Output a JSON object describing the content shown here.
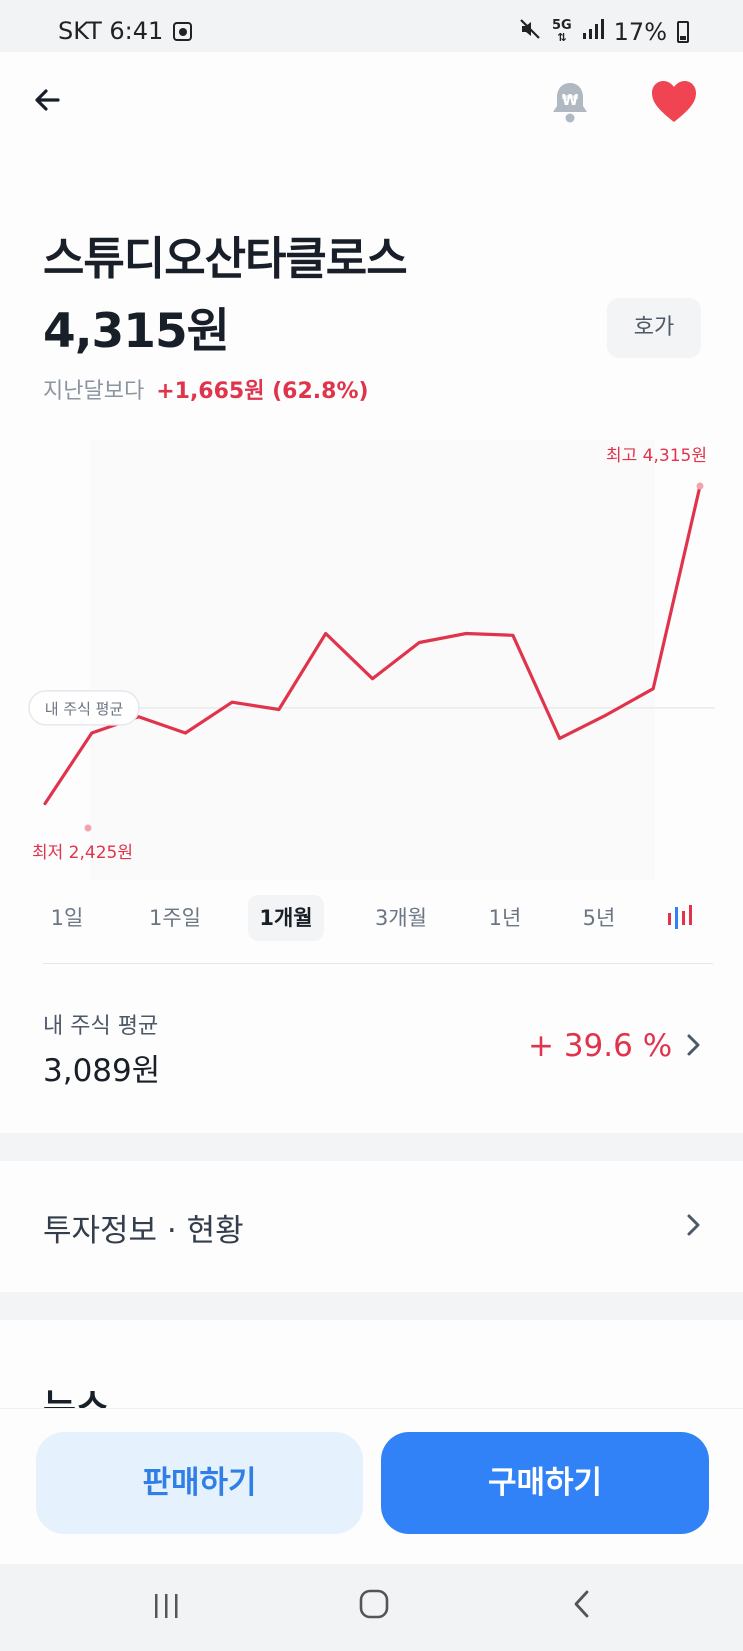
{
  "status_bar": {
    "carrier_time": "SKT 6:41",
    "battery": "17%",
    "network": "5G",
    "icons": [
      "clock-app-icon",
      "mute-icon",
      "5g-icon",
      "signal-icon",
      "battery-icon"
    ]
  },
  "header": {
    "back_icon": "arrow-left-icon",
    "alert_icon": "bell-won-icon",
    "favorite_icon": "heart-icon",
    "favorite_color": "#f04452"
  },
  "stock": {
    "name": "스튜디오산타클로스",
    "price": "4,315원",
    "orderbook_label": "호가",
    "change_label": "지난달보다",
    "change_value": "+1,665원 (62.8%)"
  },
  "chart_data": {
    "type": "line",
    "series": [
      {
        "values": [
          2560,
          2950,
          3040,
          2950,
          3120,
          3080,
          3500,
          3250,
          3450,
          3500,
          3490,
          2920,
          3050,
          3195,
          4315
        ]
      }
    ],
    "high_label": "최고 4,315원",
    "low_label": "최저 2,425원",
    "low_value": 2425,
    "average_label": "내 주식 평균",
    "average_value": 3089,
    "ylim": [
      2425,
      4315
    ],
    "color": "#e0344c"
  },
  "period_tabs": [
    "1일",
    "1주일",
    "1개월",
    "3개월",
    "1년",
    "5년"
  ],
  "period_active": "1개월",
  "candle_icon": "candlestick-chart-icon",
  "my_average": {
    "label": "내 주식 평균",
    "value": "3,089원",
    "return": "+ 39.6 %"
  },
  "invest_info": {
    "label": "투자정보 · 현황"
  },
  "news": {
    "title": "뉴스"
  },
  "actions": {
    "sell": "판매하기",
    "buy": "구매하기"
  },
  "nav": {
    "icons": [
      "recent-apps-icon",
      "home-icon",
      "back-icon"
    ]
  },
  "colors": {
    "accent_red": "#e0344c",
    "accent_blue": "#3182f6",
    "light_blue": "#e6f1fe"
  }
}
